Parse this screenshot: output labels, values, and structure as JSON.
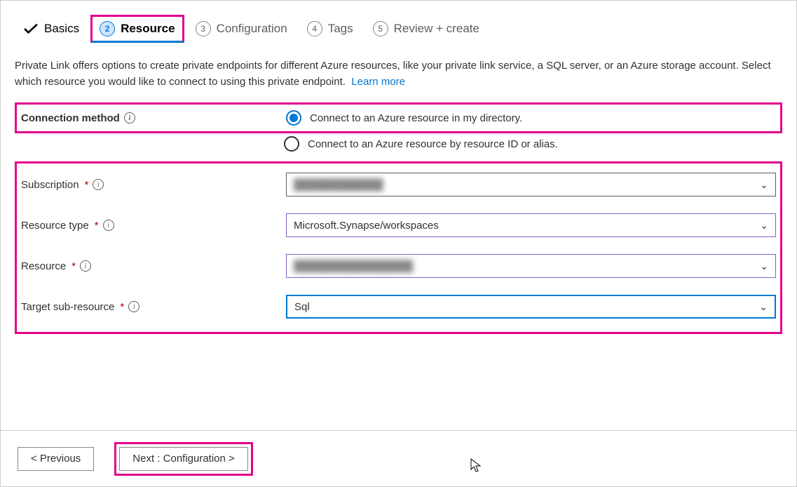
{
  "tabs": {
    "basics": "Basics",
    "resource": "Resource",
    "configuration": "Configuration",
    "tags": "Tags",
    "review": "Review + create",
    "num2": "2",
    "num3": "3",
    "num4": "4",
    "num5": "5"
  },
  "description": {
    "text": "Private Link offers options to create private endpoints for different Azure resources, like your private link service, a SQL server, or an Azure storage account. Select which resource you would like to connect to using this private endpoint.",
    "learn_more": "Learn more"
  },
  "labels": {
    "connection_method": "Connection method",
    "subscription": "Subscription",
    "resource_type": "Resource type",
    "resource": "Resource",
    "target_sub_resource": "Target sub-resource"
  },
  "options": {
    "conn_my_dir": "Connect to an Azure resource in my directory.",
    "conn_by_id": "Connect to an Azure resource by resource ID or alias."
  },
  "values": {
    "subscription": "████████████",
    "resource_type": "Microsoft.Synapse/workspaces",
    "resource": "████████████████",
    "target_sub_resource": "Sql"
  },
  "buttons": {
    "previous": "< Previous",
    "next": "Next : Configuration >"
  },
  "asterisk": "*"
}
